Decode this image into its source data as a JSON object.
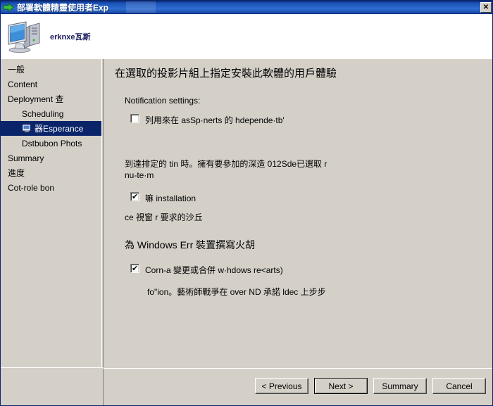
{
  "window": {
    "title": "部署軟體精靈使用者Exp",
    "title_icon": "green-arrow-icon",
    "close_label": "✕"
  },
  "header": {
    "icon": "computer-icon",
    "caption": "erknxe瓦斯"
  },
  "sidebar": {
    "items": [
      {
        "label": "一般",
        "level": 0,
        "selected": false,
        "icon": null
      },
      {
        "label": "Content",
        "level": 0,
        "selected": false,
        "icon": null
      },
      {
        "label": "Deployment 查",
        "level": 0,
        "selected": false,
        "icon": null
      },
      {
        "label": "Scheduling",
        "level": 1,
        "selected": false,
        "icon": null
      },
      {
        "label": "器Esperance",
        "level": 1,
        "selected": true,
        "icon": "page-icon"
      },
      {
        "label": "Dstbubon Phots",
        "level": 1,
        "selected": false,
        "icon": null
      },
      {
        "label": "Summary",
        "level": 0,
        "selected": false,
        "icon": null
      },
      {
        "label": "進度",
        "level": 0,
        "selected": false,
        "icon": null
      },
      {
        "label": "Cot-role bon",
        "level": 0,
        "selected": false,
        "icon": null
      }
    ]
  },
  "content": {
    "heading": "在選取的投影片組上指定安裝此軟體的用戶體驗",
    "notification_label": "Notification settings:",
    "checkbox_notify": {
      "checked": false,
      "label": "列用來在 asSp·nerts 的 hdepende·tb'"
    },
    "paragraph_1_line_1": "到達排定的 tin 時。擁有要參加的深造 012Sde已選取 r",
    "paragraph_1_line_2": "nu-te·m",
    "checkbox_install": {
      "checked": true,
      "label": "嘛          installation"
    },
    "note_install": "ce 視窗 r 要求的沙丘",
    "section_heading": "為 Windows Err 裝置撰寫火胡",
    "checkbox_commit": {
      "checked": true,
      "label": "Corn-a 變更或合併 w·hdows re<arts)"
    },
    "note_commit": "fo\"ion。藝術師戰爭在 over ND 承諾 ldec 上步步"
  },
  "footer": {
    "buttons": [
      {
        "label": "< Previous",
        "default": false
      },
      {
        "label": "Next >",
        "default": true
      },
      {
        "label": "Summary",
        "default": false
      },
      {
        "label": "Cancel",
        "default": false
      }
    ]
  }
}
